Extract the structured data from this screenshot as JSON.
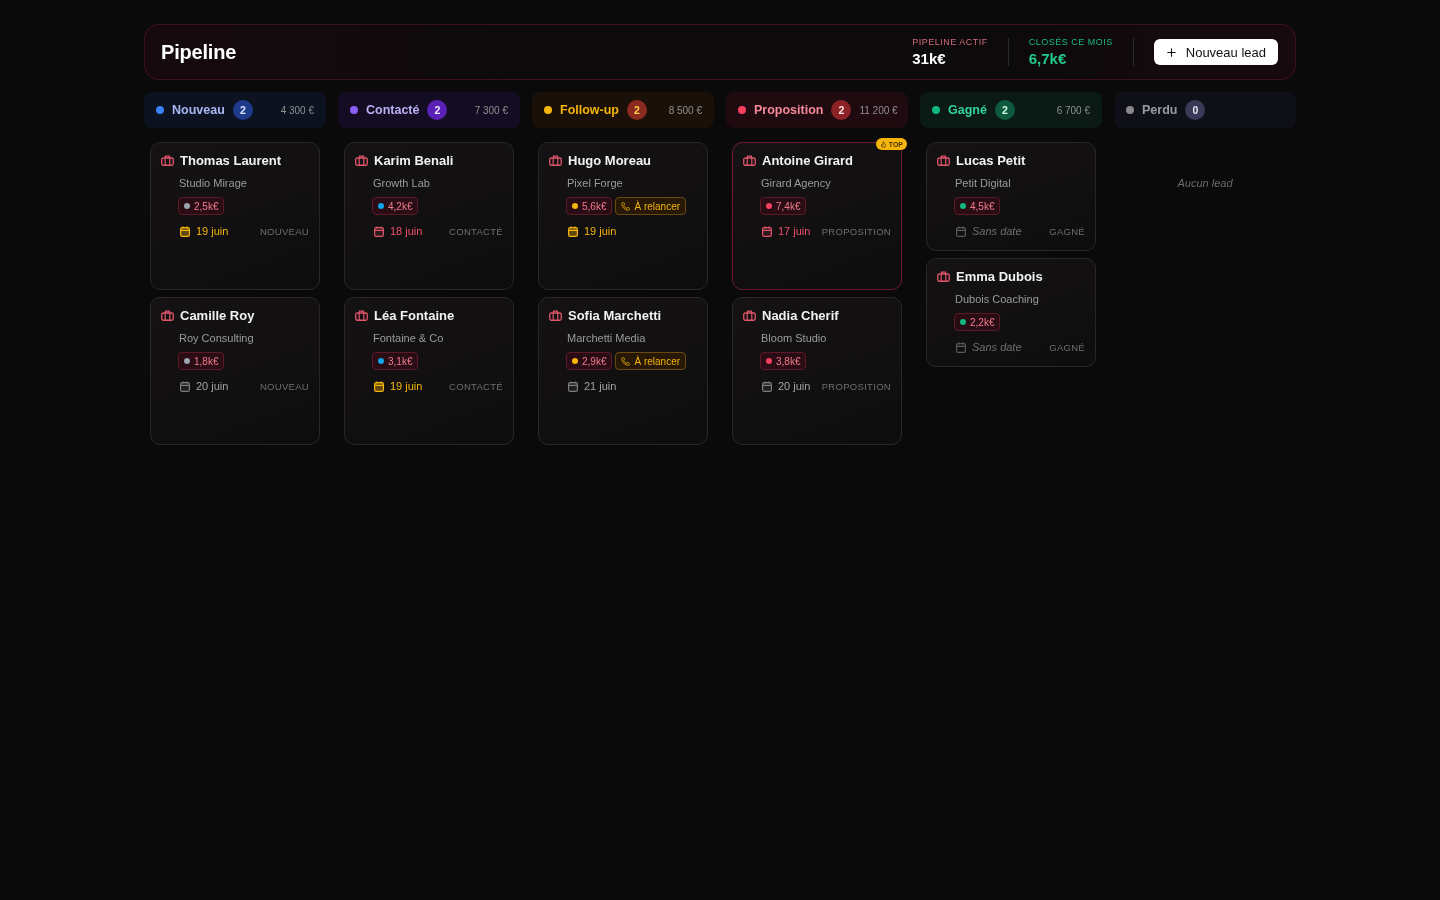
{
  "header": {
    "title": "Pipeline",
    "stats": [
      {
        "kind": "active",
        "label": "PIPELINE ACTIF",
        "value": "31k€"
      },
      {
        "kind": "closed",
        "label": "CLOSÉS CE MOIS",
        "value": "6,7k€"
      }
    ],
    "button": {
      "label": "Nouveau lead"
    }
  },
  "columns": [
    {
      "kind": "new",
      "title": "Nouveau",
      "color": "#3b82f6",
      "count": "2",
      "total": "4 300 €",
      "cards": [
        {
          "kind": "soon",
          "name": "Thomas Laurent",
          "company": "Studio Mirage",
          "amount": "2,5k€",
          "color": "#9ca3af",
          "date": "19 juin",
          "stage_label": "NOUVEAU"
        },
        {
          "kind": "later",
          "name": "Camille Roy",
          "company": "Roy Consulting",
          "amount": "1,8k€",
          "color": "#9ca3af",
          "date": "20 juin",
          "stage_label": "NOUVEAU"
        }
      ]
    },
    {
      "kind": "contacted",
      "title": "Contacté",
      "color": "#8b5cf6",
      "count": "2",
      "total": "7 300 €",
      "cards": [
        {
          "kind": "overdue",
          "name": "Karim Benali",
          "company": "Growth Lab",
          "amount": "4,2k€",
          "color": "#0ea5e9",
          "date": "18 juin",
          "stage_label": "CONTACTÉ"
        },
        {
          "kind": "soon",
          "name": "Léa Fontaine",
          "company": "Fontaine & Co",
          "amount": "3,1k€",
          "color": "#0ea5e9",
          "date": "19 juin",
          "stage_label": "CONTACTÉ"
        }
      ]
    },
    {
      "kind": "follow_up",
      "title": "Follow-up",
      "color": "#f5b50a",
      "count": "2",
      "total": "8 500 €",
      "cards": [
        {
          "kind": "soon",
          "name": "Hugo Moreau",
          "company": "Pixel Forge",
          "amount": "5,6k€",
          "color": "#f5b50a",
          "follow_up": "À relancer",
          "date": "19 juin"
        },
        {
          "kind": "later",
          "name": "Sofia Marchetti",
          "company": "Marchetti Media",
          "amount": "2,9k€",
          "color": "#f5b50a",
          "follow_up": "À relancer",
          "date": "21 juin"
        }
      ]
    },
    {
      "kind": "proposal",
      "title": "Proposition",
      "color": "#f43f5e",
      "count": "2",
      "total": "11 200 €",
      "cards": [
        {
          "kind": "overdue",
          "name": "Antoine Girard",
          "company": "Girard Agency",
          "badge": "TOP",
          "amount": "7,4k€",
          "color": "#f43f5e",
          "date": "17 juin",
          "stage_label": "PROPOSITION"
        },
        {
          "kind": "later",
          "name": "Nadia Cherif",
          "company": "Bloom Studio",
          "amount": "3,8k€",
          "color": "#f43f5e",
          "date": "20 juin",
          "stage_label": "PROPOSITION"
        }
      ]
    },
    {
      "kind": "won",
      "title": "Gagné",
      "color": "#10b981",
      "count": "2",
      "total": "6 700 €",
      "cards": [
        {
          "kind": "undated",
          "name": "Lucas Petit",
          "company": "Petit Digital",
          "amount": "4,5k€",
          "color": "#10b981",
          "date": "Sans date",
          "stage_label": "GAGNÉ"
        },
        {
          "kind": "undated",
          "name": "Emma Dubois",
          "company": "Dubois Coaching",
          "amount": "2,2k€",
          "color": "#10b981",
          "date": "Sans date",
          "stage_label": "GAGNÉ"
        }
      ]
    },
    {
      "kind": "lost",
      "title": "Perdu",
      "color": "#8a8a8a",
      "count": "0",
      "empty_text": "Aucun lead"
    }
  ]
}
